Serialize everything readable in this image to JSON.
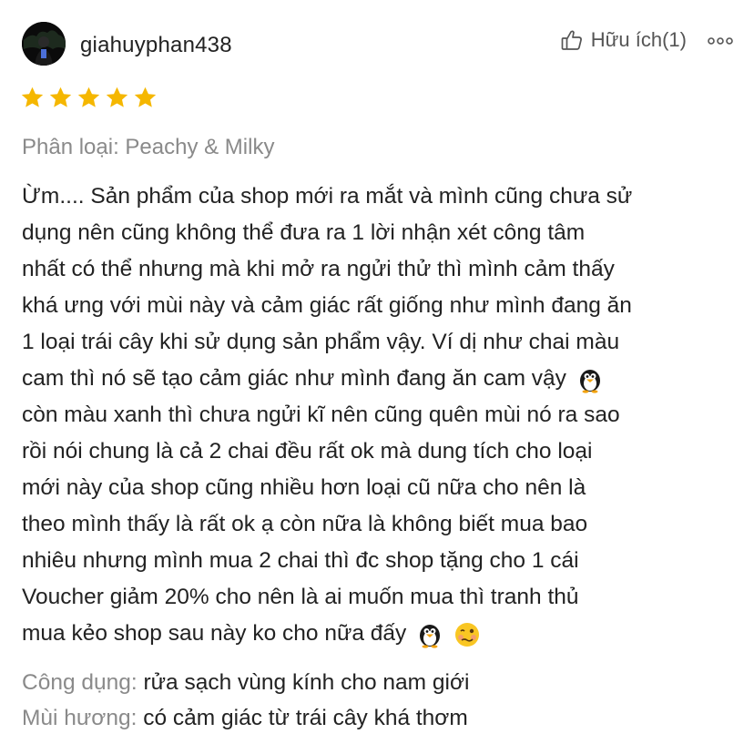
{
  "review": {
    "username": "giahuyphan438",
    "helpful_label": "Hữu ích(1)",
    "rating": 5,
    "variant_text": "Phân loại: Peachy & Milky",
    "content_lines": [
      "Ừm.... Sản phẩm của shop mới ra mắt và mình cũng chưa sử",
      "dụng nên cũng không thể đưa ra 1 lời nhận xét công tâm",
      "nhất có thể nhưng mà khi mở ra ngửi thử thì mình cảm thấy",
      "khá ưng với mùi này và cảm giác rất giống như mình đang ăn",
      "1 loại trái cây khi sử dụng sản phẩm vậy. Ví dị như chai màu",
      "cam thì nó sẽ tạo cảm giác như mình đang ăn cam vậy",
      "còn màu xanh thì chưa ngửi kĩ nên cũng quên mùi nó ra sao",
      "rồi nói chung là cả 2 chai đều rất ok mà dung tích cho loại",
      "mới này của shop cũng nhiều hơn loại cũ nữa cho nên là",
      "theo mình thấy là rất ok ạ còn nữa là không biết mua bao",
      "nhiêu nhưng mình mua 2 chai thì đc shop tặng cho 1 cái",
      "Voucher giảm 20% cho nên là ai muốn mua thì tranh thủ",
      "mua kẻo shop sau này ko cho nữa đấy"
    ],
    "emojis": {
      "line6": "penguin-emoji",
      "line13": [
        "penguin-emoji",
        "woozy-face-emoji"
      ]
    },
    "attributes": [
      {
        "label": "Công dụng:",
        "value": "rửa sạch vùng kính cho nam giới"
      },
      {
        "label": "Mùi hương:",
        "value": "có cảm giác từ trái cây khá thơm"
      }
    ],
    "icons": {
      "helpful": "thumbs-up-icon",
      "more": "more-options-icon",
      "star": "star-icon"
    },
    "colors": {
      "star": "#f5b700",
      "muted_text": "#8a8a8a",
      "body_text": "#222222"
    }
  }
}
